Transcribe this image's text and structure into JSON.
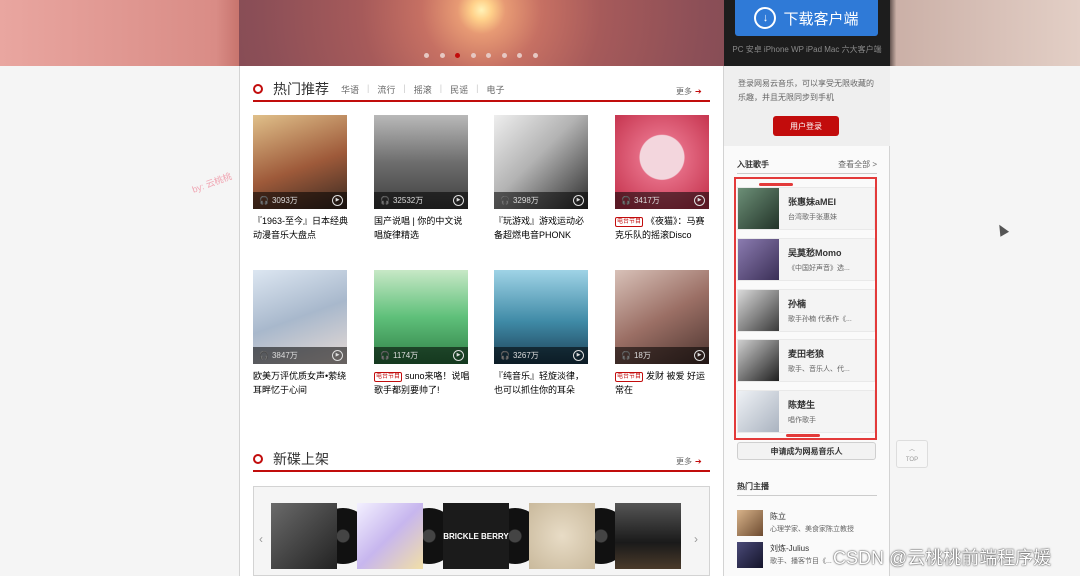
{
  "banner": {
    "download_label": "下载客户端",
    "download_sub": "PC 安卓 iPhone WP iPad Mac 六大客户端",
    "dots": 8,
    "active_dot": 3
  },
  "hot": {
    "title": "热门推荐",
    "tags": [
      "华语",
      "流行",
      "摇滚",
      "民谣",
      "电子"
    ],
    "more": "更多",
    "playlists": [
      {
        "plays": "3093万",
        "title": "『1963-至今』日本经典动漫音乐大盘点",
        "radio": false,
        "color": "#b07a55"
      },
      {
        "plays": "32532万",
        "title": "国产说唱 | 你的中文说唱旋律精选",
        "radio": false,
        "color": "#7d7d7d"
      },
      {
        "plays": "3298万",
        "title": "『玩游戏』游戏运动必备超燃电音PHONK",
        "radio": false,
        "color": "#9a9a9a"
      },
      {
        "plays": "3417万",
        "title": "《夜猫》：马赛克乐队的摇滚Disco",
        "radio": true,
        "color": "#d9556b"
      },
      {
        "plays": "3847万",
        "title": "欧美万评优质女声•萦绕耳畔忆于心间",
        "radio": false,
        "color": "#b9c6d6"
      },
      {
        "plays": "1174万",
        "title": "suno来咯！说唱歌手都别要帅了!",
        "radio": true,
        "color": "#5bb36f"
      },
      {
        "plays": "3267万",
        "title": "『纯音乐』轻旋淡律，也可以抓住你的耳朵",
        "radio": false,
        "color": "#4f8ea6"
      },
      {
        "plays": "18万",
        "title": "发财 被爱 好运常在",
        "radio": true,
        "color": "#8a6a64"
      }
    ],
    "radio_tag": "电台节目"
  },
  "new_albums": {
    "title": "新碟上架",
    "more": "更多",
    "covers": [
      "#3a3a3a",
      "#c8b9e8",
      "#1b1b1b",
      "#d7cbb4",
      "#2a2a2a"
    ],
    "featured_text": "BRICKLE BERRY"
  },
  "side": {
    "login_text": "登录网易云音乐，可以享受无限收藏的乐趣，并且无限同步到手机",
    "login_button": "用户登录",
    "singers_title": "入驻歌手",
    "singers_more": "查看全部 >",
    "singers": [
      {
        "name": "张惠妹aMEI",
        "desc": "台湾歌手张惠妹",
        "color": "#3d5a4a"
      },
      {
        "name": "吴莫愁Momo",
        "desc": "《中国好声音》选...",
        "color": "#4e4466"
      },
      {
        "name": "孙楠",
        "desc": "歌手孙楠 代表作《...",
        "color": "#6a6a6a"
      },
      {
        "name": "麦田老狼",
        "desc": "歌手、音乐人、代...",
        "color": "#3b3b3b"
      },
      {
        "name": "陈楚生",
        "desc": "唱作歌手",
        "color": "#c8d0da"
      }
    ],
    "apply_button": "申请成为网易音乐人",
    "anchors_title": "热门主播",
    "anchors": [
      {
        "name": "陈立",
        "desc": "心理学家、美食家陈立教授",
        "color": "#a07b5a"
      },
      {
        "name": "刘炼-Julius",
        "desc": "歌手、播客节目《...",
        "color": "#2b2b40"
      }
    ]
  },
  "top_button": "TOP",
  "watermark": "by: 云桃桃",
  "csdn_mark": "CSDN @云桃桃前端程序媛"
}
